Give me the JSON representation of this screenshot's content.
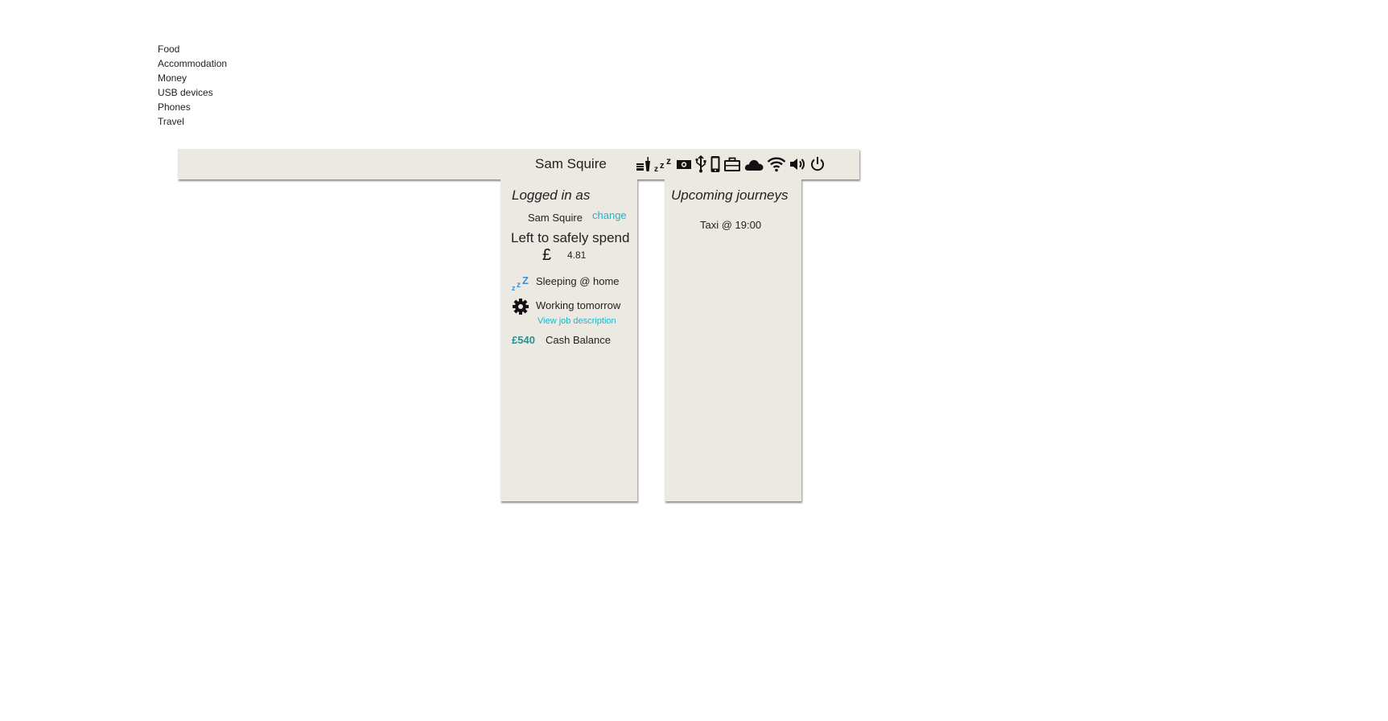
{
  "menu": {
    "items": [
      "Food",
      "Accommodation",
      "Money",
      "USB devices",
      "Phones",
      "Travel"
    ]
  },
  "topbar": {
    "user_name": "Sam Squire",
    "icons": [
      "food-drink-icon",
      "sleep-icon",
      "money-icon",
      "usb-icon",
      "phone-icon",
      "briefcase-icon",
      "cloud-icon",
      "wifi-icon",
      "volume-icon",
      "power-icon"
    ]
  },
  "status_panel": {
    "logged_in_heading": "Logged in as",
    "user_name": "Sam Squire",
    "change_link": "change",
    "spend_heading": "Left to safely spend",
    "currency_symbol": "£",
    "spend_amount": "4.81",
    "sleeping_text": "Sleeping @ home",
    "working_text": "Working tomorrow",
    "job_link": "View job description",
    "cash_amount": "£540",
    "cash_label": "Cash Balance"
  },
  "journeys_panel": {
    "heading": "Upcoming journeys",
    "items": [
      "Taxi @ 19:00"
    ]
  },
  "colors": {
    "panel_bg": "#ece9e3",
    "link": "#1fb5c6",
    "cash": "#2a8f8f",
    "sleep_icon": "#3a8fd6"
  }
}
